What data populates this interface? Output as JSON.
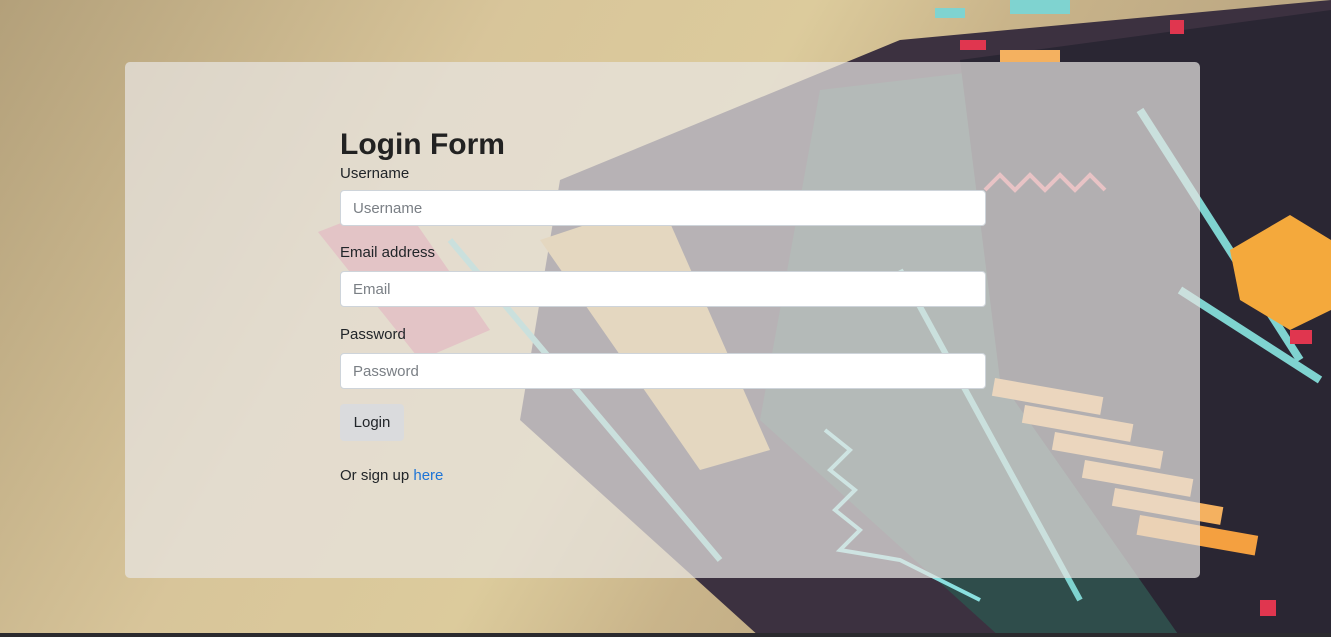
{
  "form": {
    "title": "Login Form",
    "username_label": "Username",
    "username_placeholder": "Username",
    "email_label": "Email address",
    "email_placeholder": "Email",
    "password_label": "Password",
    "password_placeholder": "Password",
    "login_button": "Login",
    "signup_prefix": "Or sign up ",
    "signup_link": "here"
  },
  "colors": {
    "link": "#1e74d6",
    "button_bg": "#dadbdd"
  }
}
